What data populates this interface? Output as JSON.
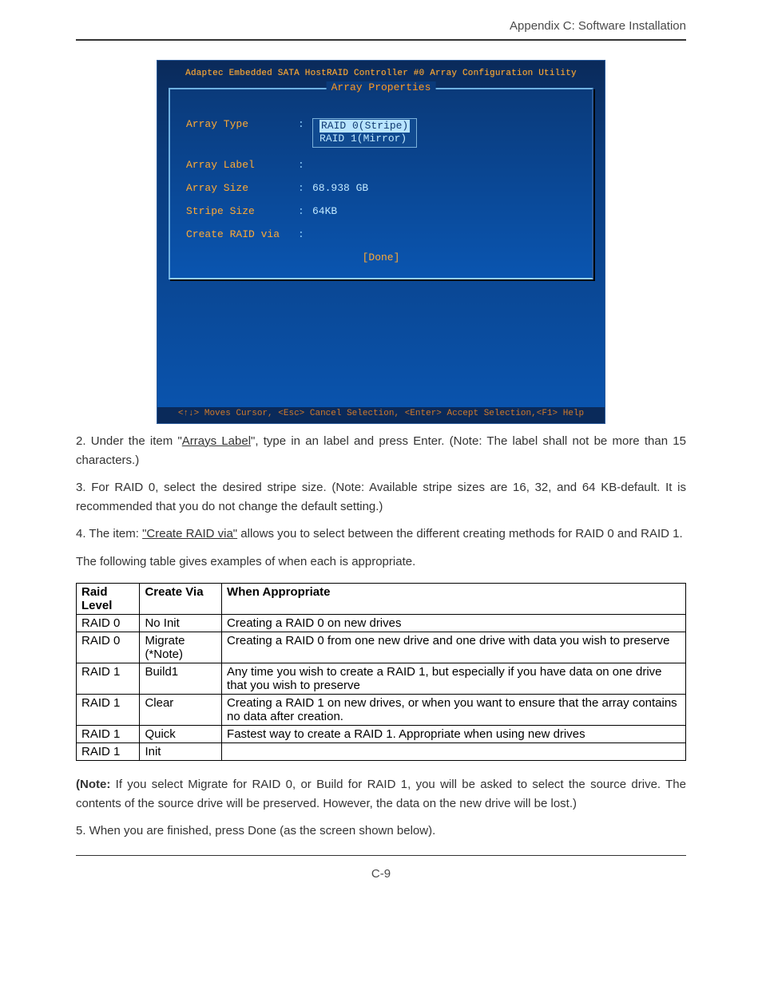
{
  "header": "Appendix C: Software Installation",
  "bios": {
    "title_bar": "Adaptec Embedded SATA HostRAID Controller #0 Array Configuration Utility",
    "panel_title": "Array Properties",
    "rows": {
      "array_type_label": "Array Type",
      "array_type_opt1": "RAID 0(Stripe)",
      "array_type_opt2": "RAID 1(Mirror)",
      "array_label_label": "Array Label",
      "array_label_value": "",
      "array_size_label": "Array Size",
      "array_size_value": "68.938 GB",
      "stripe_size_label": "Stripe Size",
      "stripe_size_value": "64KB",
      "create_via_label": "Create RAID via",
      "create_via_value": ""
    },
    "done": "[Done]",
    "footer": "<↑↓> Moves Cursor, <Esc> Cancel Selection, <Enter> Accept Selection,<F1> Help"
  },
  "paragraphs": {
    "p2a": "2. Under the item \"",
    "p2_u": "Arrays Label",
    "p2b": "\",  type in an label and press Enter. (Note: The label shall not be more than 15 characters.)",
    "p3": "3. For RAID 0, select the desired stripe size. (Note: Available stripe sizes are 16, 32, and 64 KB-default. It is recommended that you do not change the default setting.)",
    "p4a": "4. The item: ",
    "p4_u": "\"Create RAID via\"",
    "p4b": " allows you to select between the different creating methods for RAID 0 and RAID 1.",
    "intro": "The following table gives examples of when each is appropriate."
  },
  "table": {
    "headers": {
      "c1": "Raid Level",
      "c2": "Create Via",
      "c3": "When Appropriate"
    },
    "rows": [
      {
        "c1": "RAID 0",
        "c2": "No Init",
        "c3": "Creating a RAID 0 on new drives"
      },
      {
        "c1": "RAID 0",
        "c2": "Migrate (*Note)",
        "c3": "Creating a RAID 0 from one new drive and one drive with data you wish to preserve"
      },
      {
        "c1": "RAID 1",
        "c2": "Build1",
        "c3": "Any time you wish to create a RAID 1, but especially if you have data on one drive that you wish to preserve"
      },
      {
        "c1": "RAID 1",
        "c2": "Clear",
        "c3": "Creating a RAID 1 on new drives, or when you want to ensure that the array contains no data after creation."
      },
      {
        "c1": "RAID 1",
        "c2": "Quick",
        "c3": "Fastest way to create a RAID 1. Appropriate when using new drives"
      },
      {
        "c1": "RAID 1",
        "c2": "Init",
        "c3": ""
      }
    ]
  },
  "note": {
    "label": "(Note:",
    "text": " If you select Migrate for RAID 0, or Build for RAID 1, you will be asked to select the source drive. The contents of the source drive will be preserved. However, the data on the new drive will be lost.)"
  },
  "p5": "5. When you are finished, press Done (as the screen shown below).",
  "page_number": "C-9"
}
